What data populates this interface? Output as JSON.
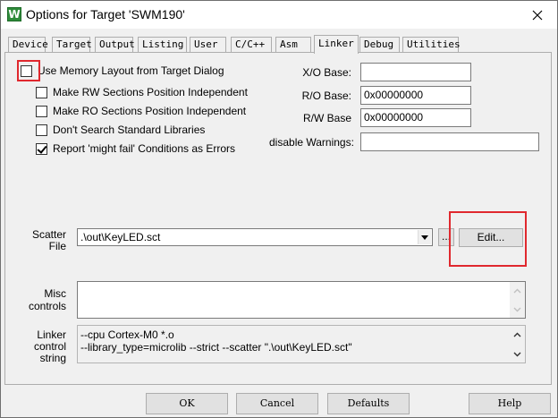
{
  "window": {
    "title": "Options for Target 'SWM190'",
    "app_icon": "W"
  },
  "tabs": [
    {
      "label": "Device"
    },
    {
      "label": "Target"
    },
    {
      "label": "Output"
    },
    {
      "label": "Listing"
    },
    {
      "label": "User"
    },
    {
      "label": "C/C++"
    },
    {
      "label": "Asm"
    },
    {
      "label": "Linker"
    },
    {
      "label": "Debug"
    },
    {
      "label": "Utilities"
    }
  ],
  "active_tab": "Linker",
  "options": {
    "use_memory_layout": {
      "label": "Use Memory Layout from Target Dialog",
      "checked": false
    },
    "rw_independent": {
      "label": "Make RW Sections Position Independent",
      "checked": false
    },
    "ro_independent": {
      "label": "Make RO Sections Position Independent",
      "checked": false
    },
    "dont_search_std_libs": {
      "label": "Don't Search Standard Libraries",
      "checked": false
    },
    "might_fail_errors": {
      "label": "Report 'might fail' Conditions as Errors",
      "checked": true
    }
  },
  "bases": {
    "xo": {
      "label": "X/O Base:",
      "value": ""
    },
    "ro": {
      "label": "R/O Base:",
      "value": "0x00000000"
    },
    "rw": {
      "label": "R/W Base",
      "value": "0x00000000"
    },
    "disable_warnings": {
      "label": "disable Warnings:",
      "value": ""
    }
  },
  "scatter": {
    "label_line1": "Scatter",
    "label_line2": "File",
    "value": ".\\out\\KeyLED.sct",
    "browse_label": "...",
    "edit_label": "Edit..."
  },
  "misc": {
    "label_line1": "Misc",
    "label_line2": "controls",
    "value": ""
  },
  "linker_control": {
    "label_line1": "Linker",
    "label_line2": "control",
    "label_line3": "string",
    "line1": "--cpu Cortex-M0 *.o",
    "line2": "--library_type=microlib --strict --scatter \".\\out\\KeyLED.sct\""
  },
  "buttons": {
    "ok": "OK",
    "cancel": "Cancel",
    "defaults": "Defaults",
    "help": "Help"
  },
  "colors": {
    "highlight": "#e0282e",
    "app_icon": "#2e8b3a"
  }
}
